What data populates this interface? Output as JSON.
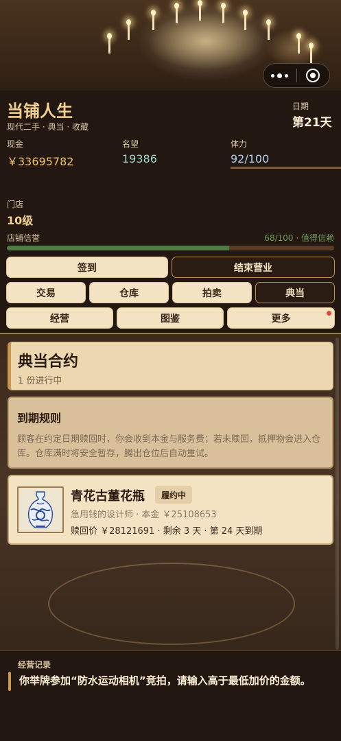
{
  "header": {
    "title": "当铺人生",
    "subtitle": "现代二手 · 典当 · 收藏",
    "date_label": "日期",
    "date_value": "第21天"
  },
  "stats": {
    "cash_label": "现金",
    "cash_value": "￥33695782",
    "fame_label": "名望",
    "fame_value": "19386",
    "stamina_label": "体力",
    "stamina_value": "92/100"
  },
  "store": {
    "level_label": "门店",
    "level_value": "10级",
    "reputation_label": "店铺信誉",
    "reputation_status": "68/100 · 值得信赖",
    "reputation_fraction": 0.68
  },
  "actions": {
    "checkin": "签到",
    "end_business": "结束营业",
    "trade": "交易",
    "warehouse": "仓库",
    "auction": "拍卖",
    "pawn": "典当",
    "operate": "经营",
    "catalog": "图鉴",
    "more": "更多"
  },
  "pawn_panel": {
    "title": "典当合约",
    "subtitle": "1 份进行中",
    "rules_title": "到期规则",
    "rules_text": "顾客在约定日期赎回时，你会收到本金与服务费；若未赎回，抵押物会进入仓库。仓库满时将安全暂存，腾出仓位后自动重试。",
    "contract": {
      "name": "青花古董花瓶",
      "status": "履约中",
      "line1": "急用钱的设计师 · 本金 ￥25108653",
      "line2": "赎回价 ￥28121691 · 剩余 3 天 · 第 24 天到期",
      "icon": "porcelain-vase"
    }
  },
  "log": {
    "title": "经营记录",
    "message": "你举牌参加“防水运动相机”竞拍，请输入高于最低加价的金额。"
  },
  "colors": {
    "accent_gold": "#f2d08d",
    "cash": "#f1c46a",
    "fame": "#9fd8c6",
    "stamina": "#a9d4ee",
    "reputation_bar": "#4f7a45",
    "notification_dot": "#e2473d"
  }
}
